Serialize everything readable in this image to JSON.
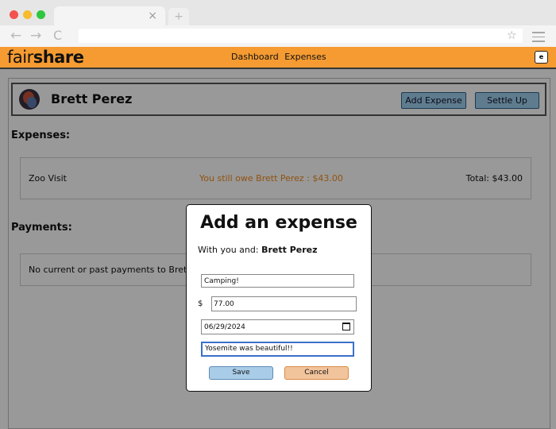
{
  "browser": {
    "tab_close": "×",
    "new_tab": "+",
    "back": "←",
    "forward": "→",
    "reload": "C",
    "star": "☆"
  },
  "app": {
    "logo_light": "fair",
    "logo_bold": "share",
    "nav": [
      "Dashboard",
      "Expenses"
    ],
    "user_initial": "e",
    "accent": "#f59b32"
  },
  "friend": {
    "name": "Brett Perez",
    "add_label": "Add Expense",
    "settle_label": "Settle Up"
  },
  "expenses": {
    "title": "Expenses:",
    "rows": [
      {
        "name": "Zoo Visit",
        "status": "You still owe Brett Perez : $43.00",
        "total": "Total: $43.00"
      }
    ]
  },
  "payments": {
    "title": "Payments:",
    "empty": "No current or past payments to Brett"
  },
  "modal": {
    "title": "Add an expense",
    "with_prefix": "With you and:",
    "with_name": "Brett Perez",
    "description": "Camping!",
    "currency": "$",
    "amount": "77.00",
    "date": "06/29/2024",
    "note": "Yosemite was beautiful!!",
    "save_label": "Save",
    "cancel_label": "Cancel"
  }
}
